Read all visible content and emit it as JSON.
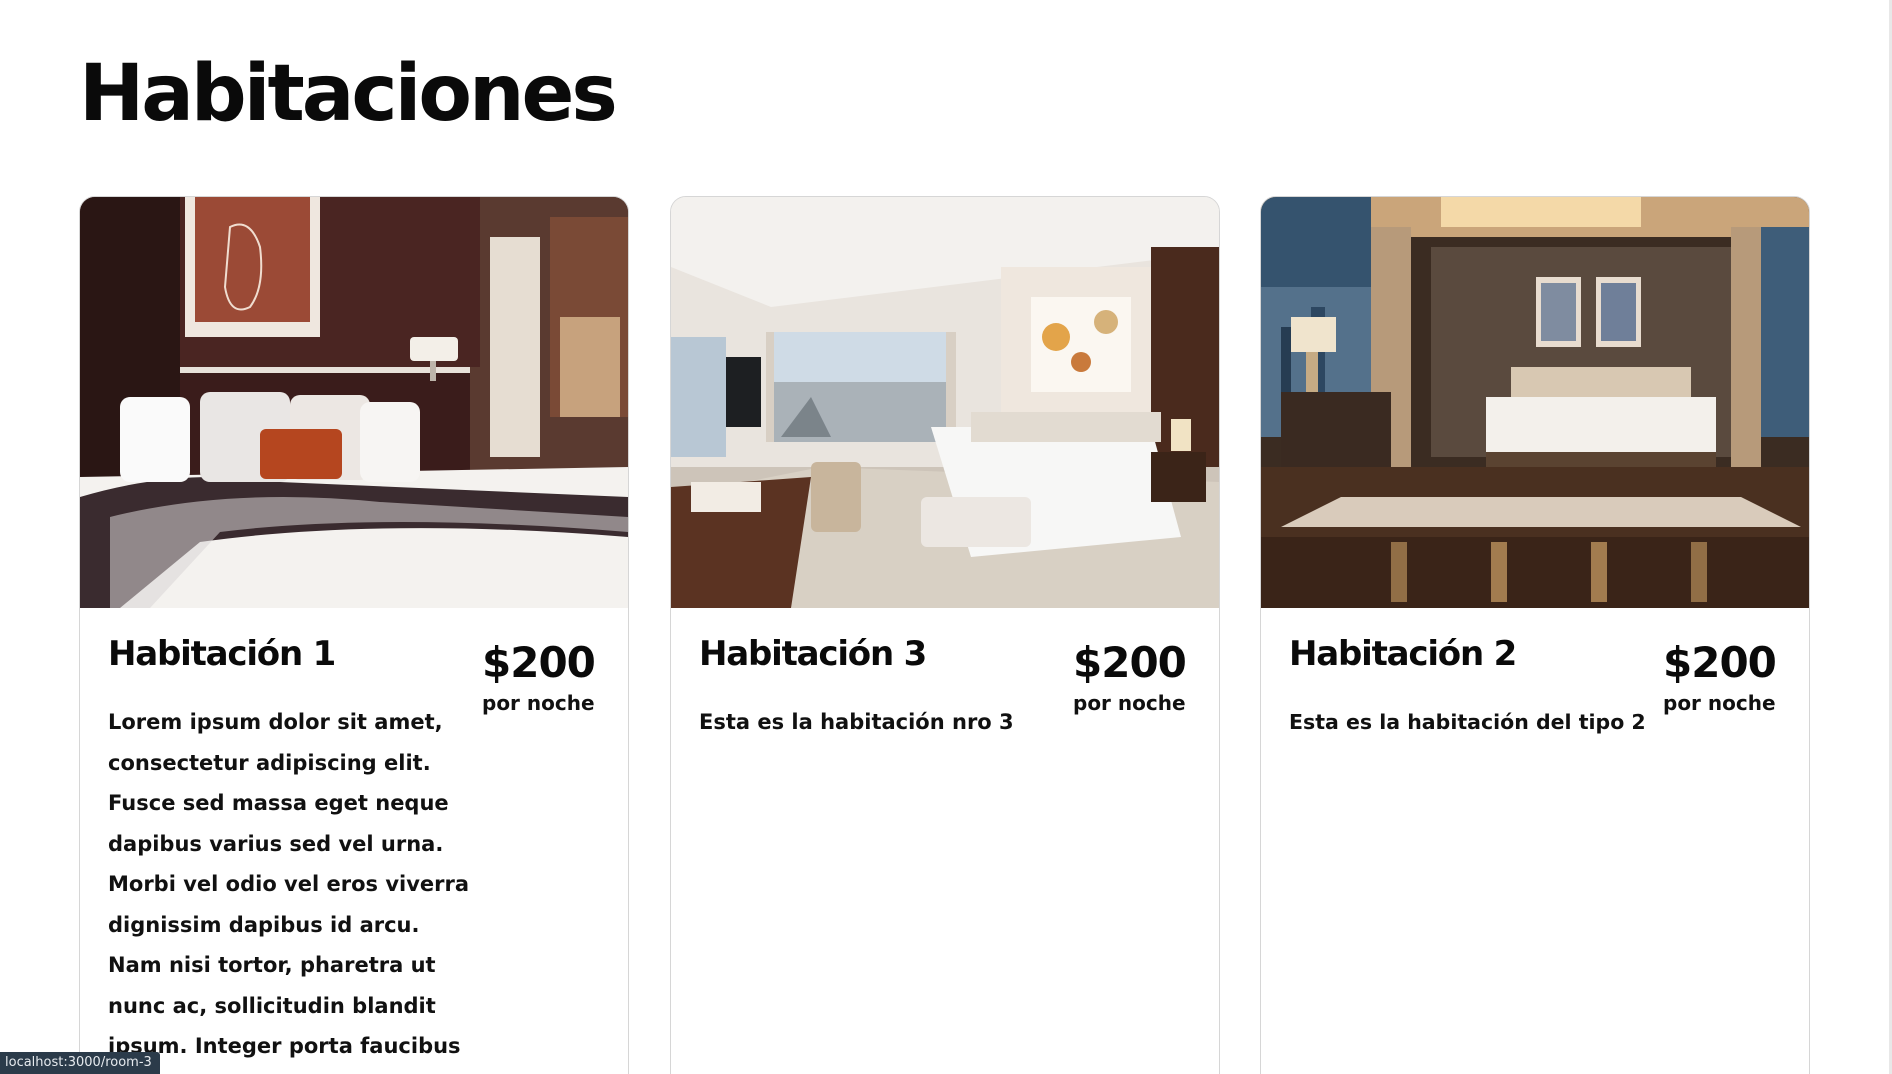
{
  "page": {
    "title": "Habitaciones"
  },
  "rooms": [
    {
      "title": "Habitación 1",
      "price": "$200",
      "price_unit": "por noche",
      "description": "Lorem ipsum dolor sit amet, consectetur adipiscing elit. Fusce sed massa eget neque dapibus varius sed vel urna. Morbi vel odio vel eros viverra dignissim dapibus id arcu. Nam nisi tortor, pharetra ut nunc ac, sollicitudin blandit ipsum. Integer porta faucibus"
    },
    {
      "title": "Habitación 3",
      "price": "$200",
      "price_unit": "por noche",
      "description": "Esta es la habitación nro 3"
    },
    {
      "title": "Habitación 2",
      "price": "$200",
      "price_unit": "por noche",
      "description": "Esta es la habitación del tipo 2"
    }
  ],
  "status_bar": {
    "url": "localhost:3000/room-3"
  }
}
